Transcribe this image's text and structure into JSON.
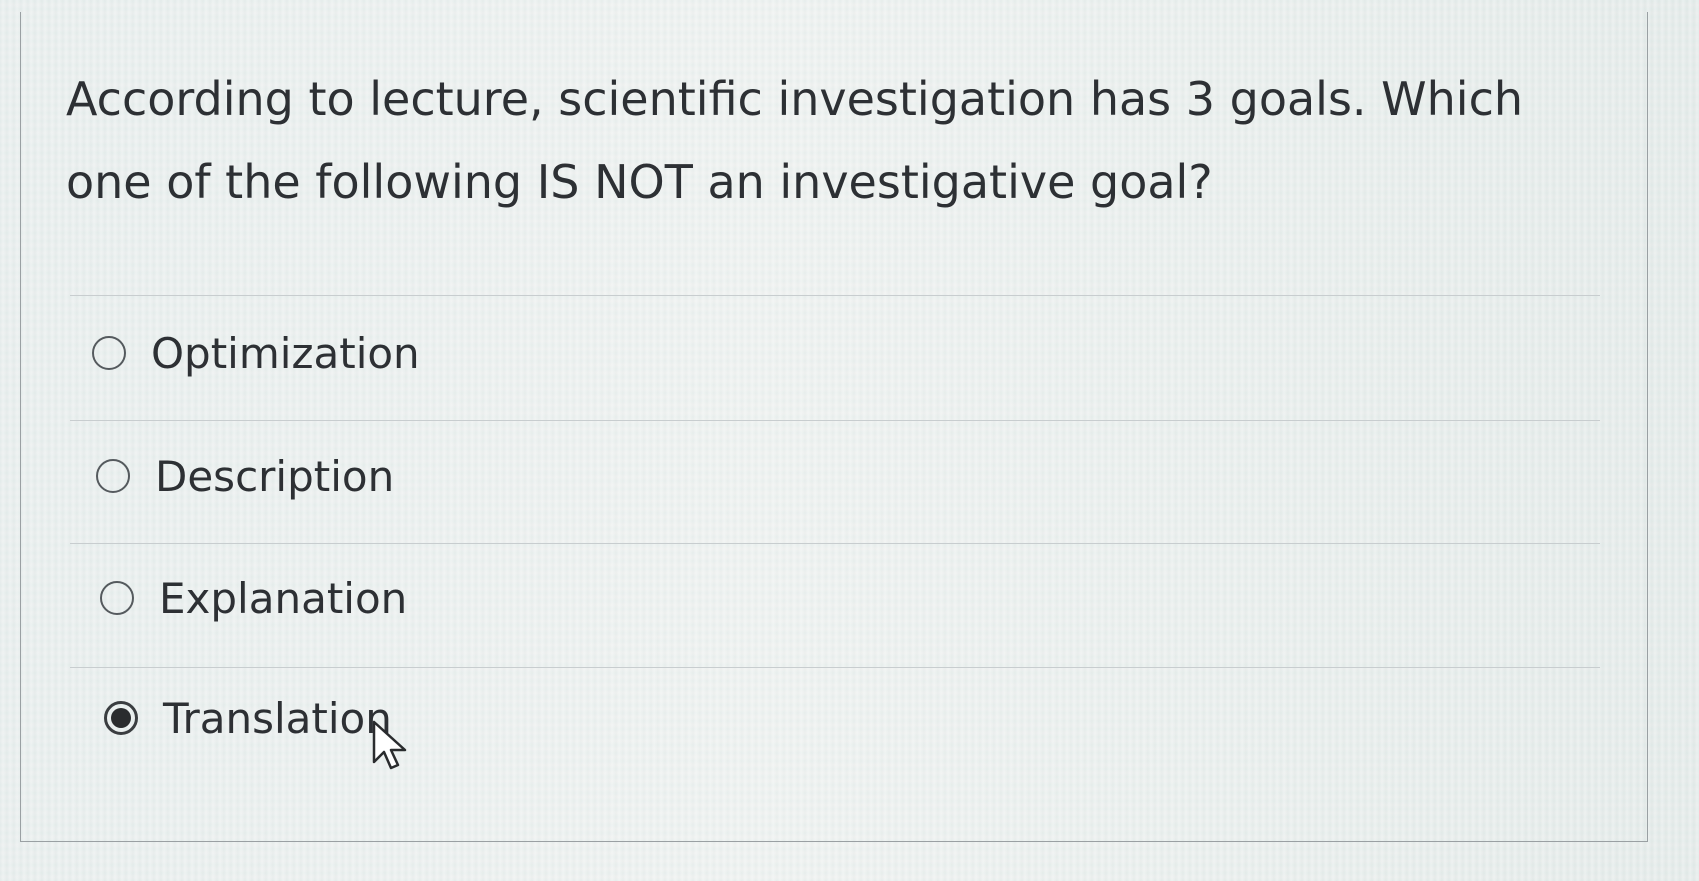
{
  "question": {
    "text": "According to lecture, scientific investigation has 3 goals.  Which one of the following IS NOT an investigative goal?"
  },
  "options": [
    {
      "label": "Optimization",
      "selected": false
    },
    {
      "label": "Description",
      "selected": false
    },
    {
      "label": "Explanation",
      "selected": false
    },
    {
      "label": "Translation",
      "selected": true
    }
  ],
  "cursor": {
    "icon": "mouse-pointer-icon"
  }
}
